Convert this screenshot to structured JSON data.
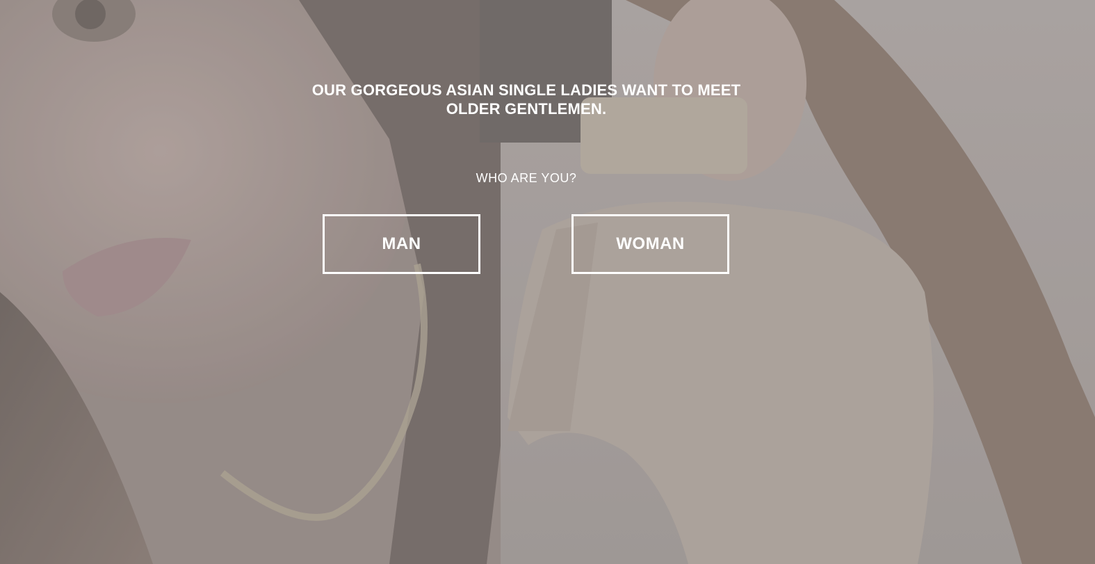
{
  "hero": {
    "headline": "OUR GORGEOUS ASIAN SINGLE LADIES WANT TO MEET OLDER GENTLEMEN.",
    "question": "WHO ARE YOU?"
  },
  "choices": {
    "man_label": "MAN",
    "woman_label": "WOMAN"
  },
  "colors": {
    "text": "#ffffff",
    "button_border": "#ffffff",
    "overlay": "#7f7a77"
  }
}
